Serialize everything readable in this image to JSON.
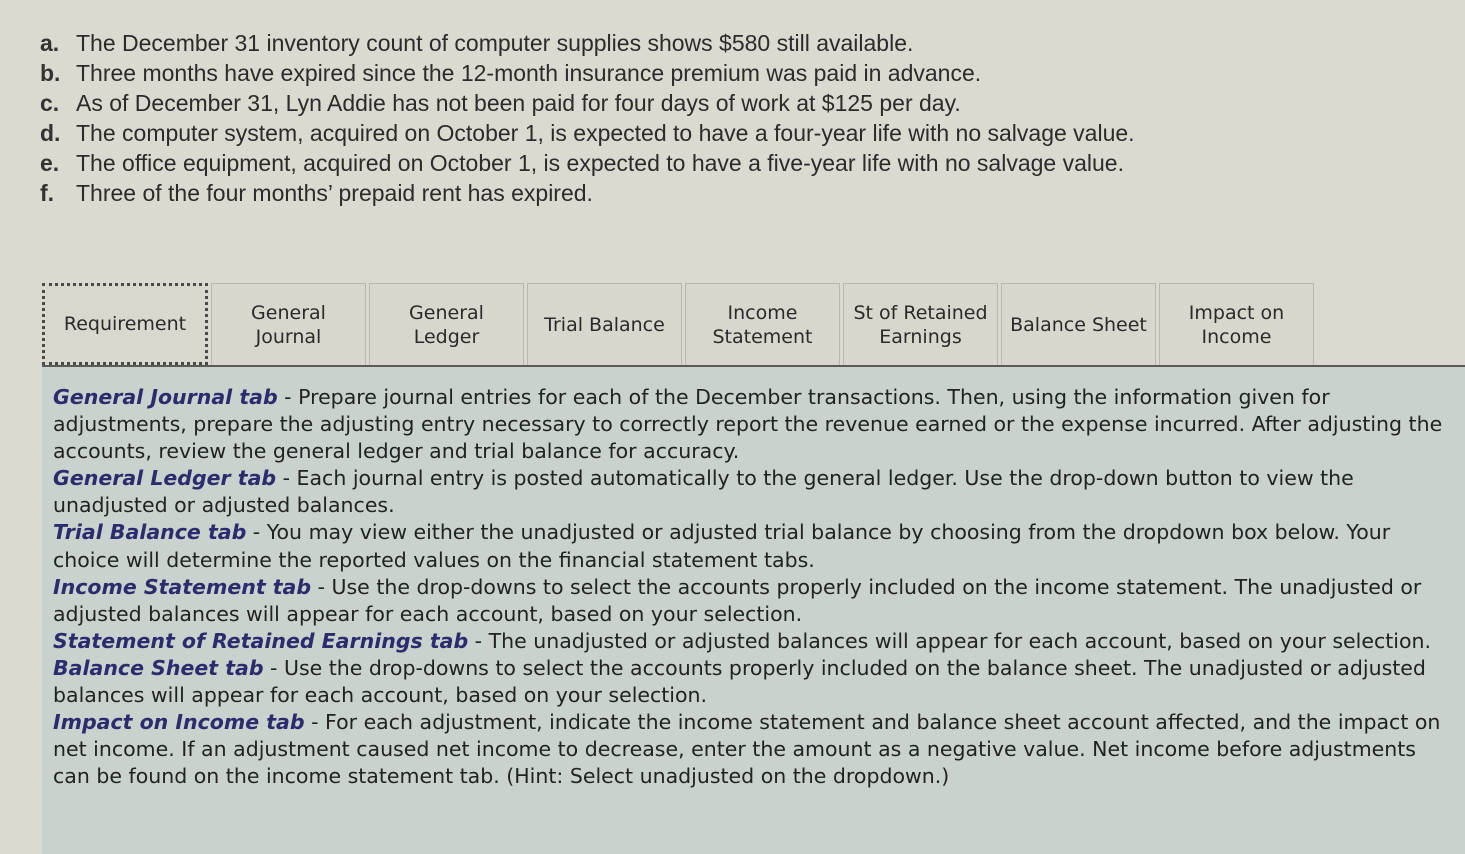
{
  "requirements": [
    {
      "letter": "a.",
      "text": "The December 31 inventory count of computer supplies shows $580 still available."
    },
    {
      "letter": "b.",
      "text": "Three months have expired since the 12-month insurance premium was paid in advance."
    },
    {
      "letter": "c.",
      "text": "As of December 31, Lyn Addie has not been paid for four days of work at $125 per day."
    },
    {
      "letter": "d.",
      "text": "The computer system, acquired on October 1, is expected to have a four-year life with no salvage value."
    },
    {
      "letter": "e.",
      "text": "The office equipment, acquired on October 1, is expected to have a five-year life with no salvage value."
    },
    {
      "letter": "f.",
      "text": "Three of the four months’ prepaid rent has expired."
    }
  ],
  "tabs": [
    {
      "label": "Requirement",
      "active": true
    },
    {
      "label": "General\nJournal",
      "active": false
    },
    {
      "label": "General\nLedger",
      "active": false
    },
    {
      "label": "Trial Balance",
      "active": false
    },
    {
      "label": "Income\nStatement",
      "active": false
    },
    {
      "label": "St of Retained\nEarnings",
      "active": false
    },
    {
      "label": "Balance Sheet",
      "active": false
    },
    {
      "label": "Impact on\nIncome",
      "active": false
    }
  ],
  "instructions": [
    {
      "title": "General Journal tab",
      "separator": " - ",
      "text": "Prepare journal entries for each of the December transactions.  Then, using the information given for adjustments, prepare the adjusting entry necessary to correctly report the revenue earned or the expense incurred.  After adjusting the accounts, review the general ledger and trial balance for accuracy."
    },
    {
      "title": "General Ledger tab",
      "separator": " - ",
      "text": "Each journal entry is posted automatically to the general ledger. Use the drop-down button to view the unadjusted or adjusted balances."
    },
    {
      "title": "Trial Balance tab",
      "separator": " - ",
      "text": "You may view either the unadjusted or adjusted trial balance by choosing from the dropdown box below.  Your choice will determine the reported values on the financial statement tabs."
    },
    {
      "title": "Income Statement tab",
      "separator": " - ",
      "text": "Use the drop-downs to select the accounts properly included on the income statement. The unadjusted or adjusted balances will appear for each account, based on your selection."
    },
    {
      "title": "Statement of Retained Earnings tab",
      "separator": " - ",
      "text": "The unadjusted or adjusted balances will appear for each account, based on your selection."
    },
    {
      "title": "Balance Sheet tab",
      "separator": " - ",
      "text": "Use the drop-downs to select the accounts properly included on the balance sheet.  The unadjusted or adjusted balances will appear for each account, based on your selection."
    },
    {
      "title": "Impact on Income tab",
      "separator": " - ",
      "text": "For each adjustment, indicate the income statement and balance sheet account affected, and the impact on net income. If an adjustment caused net income to decrease, enter the amount as a negative value.  Net income before adjustments can be found on the income statement tab.  (Hint:  Select unadjusted on the dropdown.)"
    }
  ],
  "colors": {
    "page_background": "#dcd9d0",
    "panel_background": "#c9d2cc",
    "instruction_title": "#2b2c6e"
  }
}
